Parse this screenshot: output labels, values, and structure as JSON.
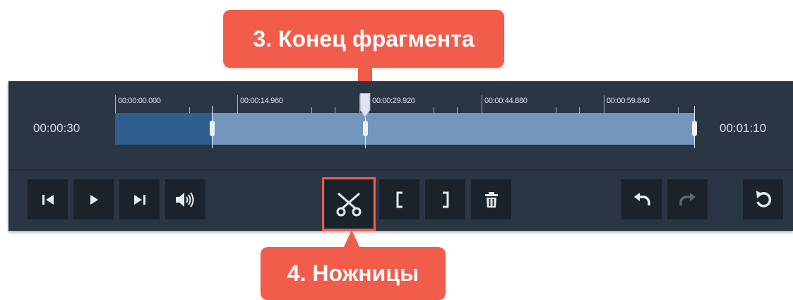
{
  "callouts": {
    "end_of_fragment": "3. Конец фрагмента",
    "scissors": "4. Ножницы"
  },
  "timeline": {
    "current_time": "00:00:30",
    "total_time": "00:01:10",
    "ruler_labels": [
      "00:00:00.000",
      "00:00:14.960",
      "00:00:29.920",
      "00:00:44.880",
      "00:00:59.840"
    ]
  },
  "controls": {
    "icons": {
      "previous": "skip-back-icon",
      "play": "play-icon",
      "next": "skip-forward-icon",
      "volume": "volume-icon",
      "split": "scissors-icon",
      "mark_in": "bracket-left-icon",
      "mark_out": "bracket-right-icon",
      "delete": "trash-icon",
      "undo": "undo-icon",
      "redo": "redo-icon",
      "reset": "reset-icon"
    }
  },
  "colors": {
    "panel": "#2b3645",
    "button": "#1a222c",
    "callout": "#f25c4a",
    "track_played": "#2f5f90",
    "track_remaining": "#7296bd"
  }
}
